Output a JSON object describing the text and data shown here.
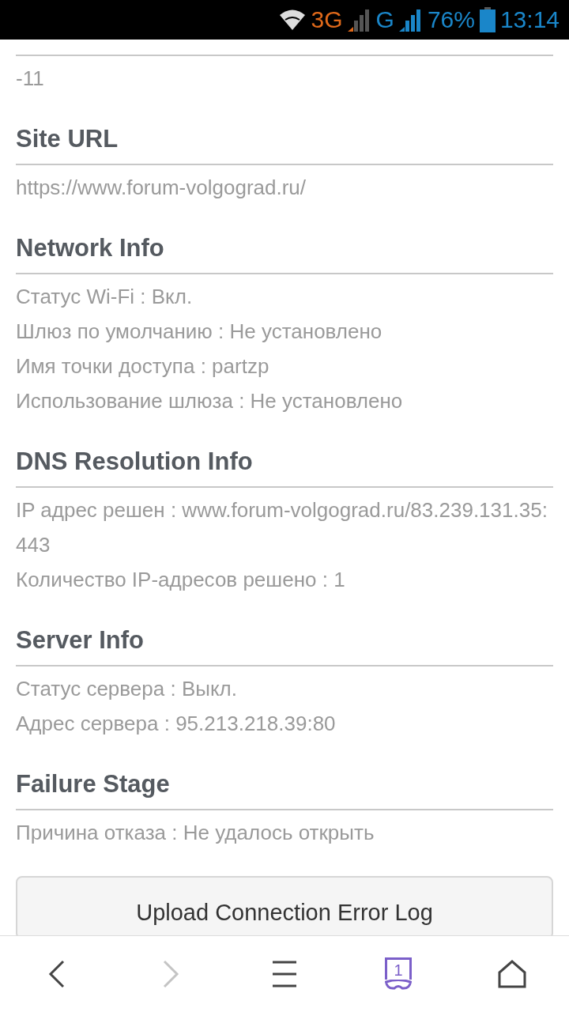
{
  "status_bar": {
    "network_1": "3G",
    "network_2": "G",
    "battery": "76%",
    "time": "13:14"
  },
  "sections": [
    {
      "lines": [
        "-11"
      ]
    },
    {
      "heading": "Site URL",
      "lines": [
        "https://www.forum-volgograd.ru/"
      ]
    },
    {
      "heading": "Network Info",
      "lines": [
        "Статус Wi-Fi : Вкл.",
        "Шлюз по умолчанию : Не установлено",
        "Имя точки доступа : partzp",
        "Использование шлюза : Не установлено"
      ]
    },
    {
      "heading": "DNS Resolution Info",
      "lines": [
        "IP адрес решен : www.forum-volgograd.ru/83.239.131.35:443",
        "Количество IP-адресов решено : 1"
      ]
    },
    {
      "heading": "Server Info",
      "lines": [
        "Статус сервера : Выкл.",
        "Адрес сервера : 95.213.218.39:80"
      ]
    },
    {
      "heading": "Failure Stage",
      "lines": [
        "Причина отказа : Не удалось открыть"
      ]
    }
  ],
  "upload_button": "Upload Connection Error Log",
  "toolbar": [
    {
      "kind": "back",
      "disabled": false
    },
    {
      "kind": "forward",
      "disabled": true
    },
    {
      "kind": "menu",
      "disabled": false
    },
    {
      "kind": "tabs",
      "disabled": false,
      "count": "1"
    },
    {
      "kind": "home",
      "disabled": false
    }
  ]
}
